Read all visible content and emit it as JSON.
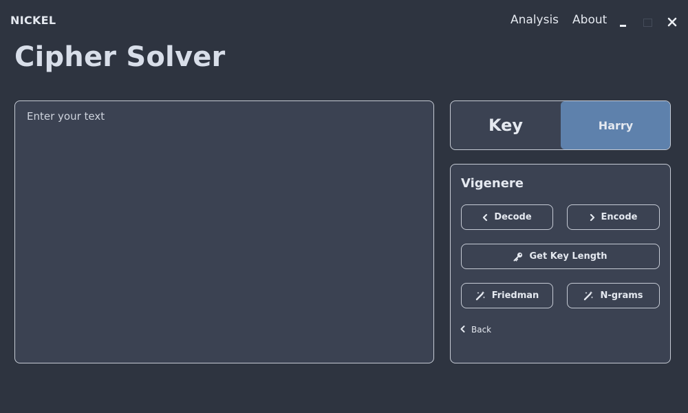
{
  "app": {
    "brand": "NICKEL"
  },
  "nav": {
    "analysis": "Analysis",
    "about": "About"
  },
  "page": {
    "title": "Cipher Solver"
  },
  "text_input": {
    "placeholder": "Enter your text",
    "value": ""
  },
  "key": {
    "label": "Key",
    "value": "Harry"
  },
  "cipher": {
    "name": "Vigenere",
    "decode_label": "Decode",
    "encode_label": "Encode",
    "key_length_label": "Get Key Length",
    "friedman_label": "Friedman",
    "ngrams_label": "N-grams",
    "back_label": "Back"
  },
  "icons": {
    "decode": "chevron-left-icon",
    "encode": "chevron-right-icon",
    "key_length": "key-icon",
    "friedman": "magic-wand-icon",
    "ngrams": "magic-wand-icon",
    "back": "chevron-left-icon"
  },
  "colors": {
    "background": "#2e3440",
    "panel": "#3b4252",
    "accent": "#5e81ac",
    "text": "#e5e9f0",
    "border": "#c7ccd6"
  }
}
